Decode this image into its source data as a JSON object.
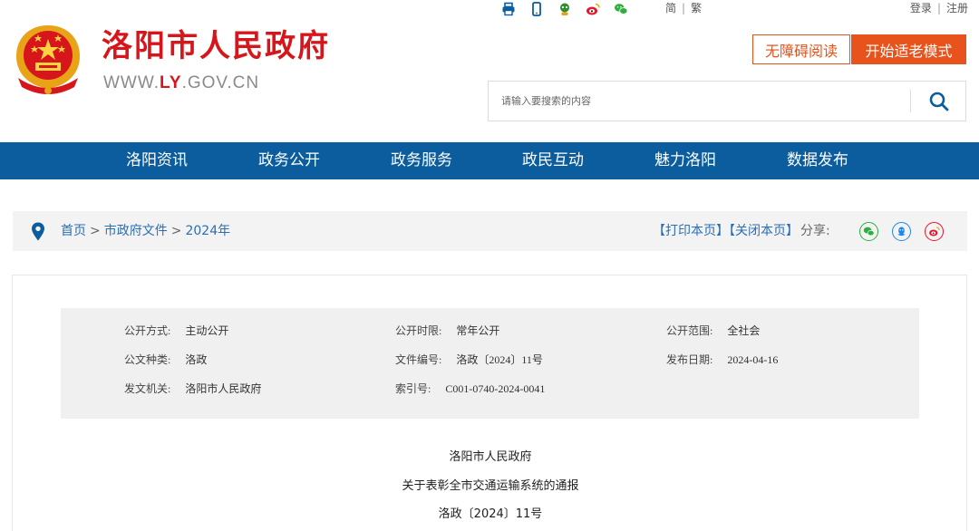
{
  "header": {
    "site_name": "洛阳市人民政府",
    "site_domain_prefix": "WWW.",
    "site_domain_highlight": "LY",
    "site_domain_suffix": ".GOV.CN",
    "brand_red": "#d7161c",
    "tool_icons": [
      "print-icon",
      "mobile-icon",
      "robot-icon",
      "weibo-icon",
      "wechat-icon"
    ],
    "lang_simplified": "简",
    "lang_traditional": "繁",
    "login": "登录",
    "register": "注册",
    "accessible_reading": "无障碍阅读",
    "elder_mode": "开始适老模式",
    "accent_orange": "#e8531d",
    "search_placeholder": "请输入要搜索的内容"
  },
  "nav": {
    "color": "#0c5d9e",
    "items": [
      "洛阳资讯",
      "政务公开",
      "政务服务",
      "政民互动",
      "魅力洛阳",
      "数据发布"
    ]
  },
  "breadcrumb": {
    "items": [
      "首页",
      "市政府文件",
      "2024年"
    ],
    "separator": ">"
  },
  "page_tools": {
    "print": "【打印本页】",
    "close": "【关闭本页】",
    "share_label": "分享:",
    "share_icons": [
      "wechat-icon",
      "qq-icon",
      "weibo-icon"
    ]
  },
  "document_meta": [
    {
      "label": "公开方式:",
      "value": "主动公开"
    },
    {
      "label": "公开时限:",
      "value": "常年公开"
    },
    {
      "label": "公开范围:",
      "value": "全社会"
    },
    {
      "label": "公文种类:",
      "value": "洛政"
    },
    {
      "label": "文件编号:",
      "value": "洛政〔2024〕11号"
    },
    {
      "label": "发布日期:",
      "value": "2024-04-16"
    },
    {
      "label": "发文机关:",
      "value": "洛阳市人民政府"
    },
    {
      "label": "索引号:",
      "value": "C001-0740-2024-0041"
    }
  ],
  "document": {
    "issuer": "洛阳市人民政府",
    "title": "关于表彰全市交通运输系统的通报",
    "number": "洛政〔2024〕11号"
  }
}
